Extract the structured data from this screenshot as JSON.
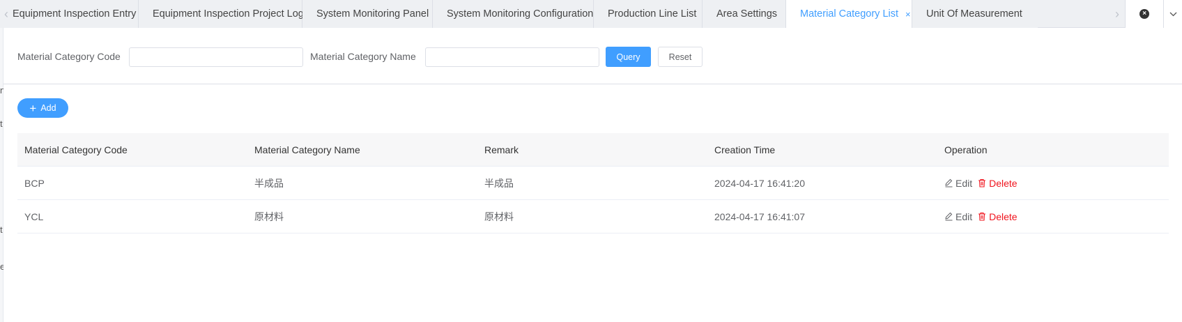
{
  "tabs": [
    {
      "label": "Equipment Inspection Entry",
      "active": false
    },
    {
      "label": "Equipment Inspection Project Log",
      "active": false
    },
    {
      "label": "System Monitoring Panel",
      "active": false
    },
    {
      "label": "System Monitoring Configuration",
      "active": false
    },
    {
      "label": "Production Line List",
      "active": false
    },
    {
      "label": "Area Settings",
      "active": false
    },
    {
      "label": "Material Category List",
      "active": true,
      "close": "×"
    },
    {
      "label": "Unit Of Measurement",
      "active": false
    }
  ],
  "tab_controls": {
    "scroll_left": "‹",
    "scroll_right": "›",
    "close_all": "×",
    "more": "⌄"
  },
  "left_stripe": [
    "n",
    "t",
    "t",
    "e"
  ],
  "search": {
    "code_label": "Material Category Code",
    "code_value": "",
    "name_label": "Material Category Name",
    "name_value": "",
    "query_label": "Query",
    "reset_label": "Reset"
  },
  "toolbar": {
    "add_label": "Add"
  },
  "table": {
    "headers": [
      "Material Category Code",
      "Material Category Name",
      "Remark",
      "Creation Time",
      "Operation"
    ],
    "rows": [
      {
        "code": "BCP",
        "name": "半成品",
        "remark": "半成品",
        "created": "2024-04-17 16:41:20"
      },
      {
        "code": "YCL",
        "name": "原材料",
        "remark": "原材料",
        "created": "2024-04-17 16:41:07"
      }
    ],
    "edit_label": "Edit",
    "delete_label": "Delete"
  },
  "colors": {
    "accent": "#409eff",
    "danger": "#f0141e"
  }
}
